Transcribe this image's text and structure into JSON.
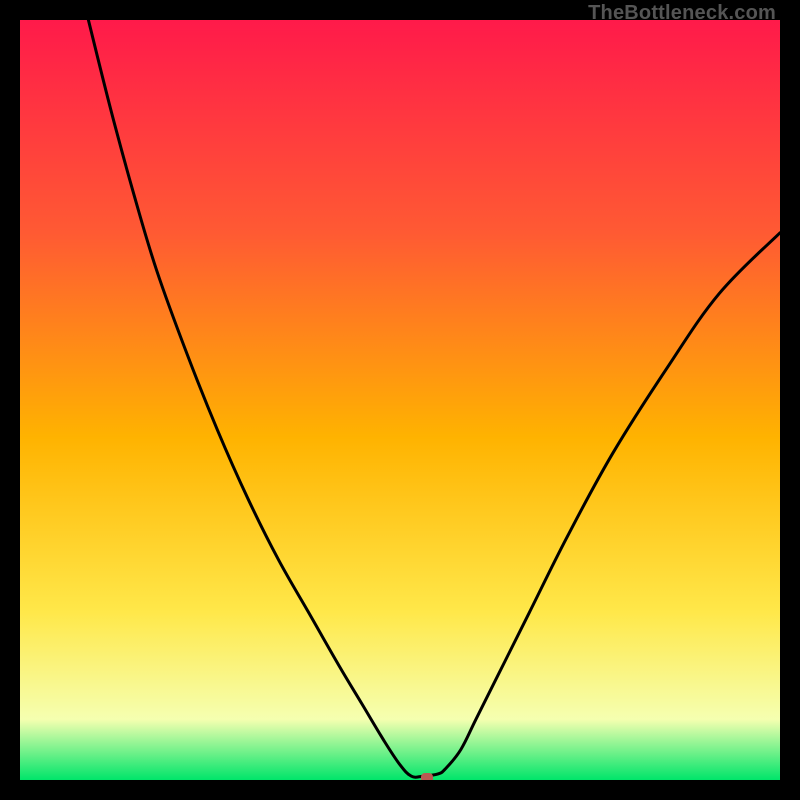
{
  "watermark": "TheBottleneck.com",
  "colors": {
    "frame": "#000000",
    "grad_top": "#ff1a4a",
    "grad_upper_mid": "#ff5a33",
    "grad_mid": "#ffb300",
    "grad_lower_mid": "#ffe84a",
    "grad_near_bottom": "#f5ffb0",
    "grad_bottom": "#00e56a",
    "curve": "#000000",
    "marker": "#b85a52"
  },
  "chart_data": {
    "type": "line",
    "title": "",
    "xlabel": "",
    "ylabel": "",
    "xlim": [
      0,
      100
    ],
    "ylim": [
      0,
      100
    ],
    "series": [
      {
        "name": "curve",
        "x": [
          9,
          12,
          15,
          18,
          22,
          26,
          30,
          34,
          38,
          42,
          45,
          48,
          50,
          51.5,
          53,
          55,
          56,
          58,
          60,
          63,
          67,
          72,
          78,
          85,
          92,
          100
        ],
        "y": [
          100,
          88,
          77,
          67,
          56,
          46,
          37,
          29,
          22,
          15,
          10,
          5,
          2,
          0.5,
          0.5,
          0.8,
          1.5,
          4,
          8,
          14,
          22,
          32,
          43,
          54,
          64,
          72
        ],
        "note": "Values are approximate percentages read from the curve shape; no axes or tick labels are present in the image."
      }
    ],
    "marker": {
      "x": 53.5,
      "y": 0.3
    },
    "flat_segment": {
      "x_from": 51.5,
      "x_to": 55,
      "y": 0.5
    }
  }
}
